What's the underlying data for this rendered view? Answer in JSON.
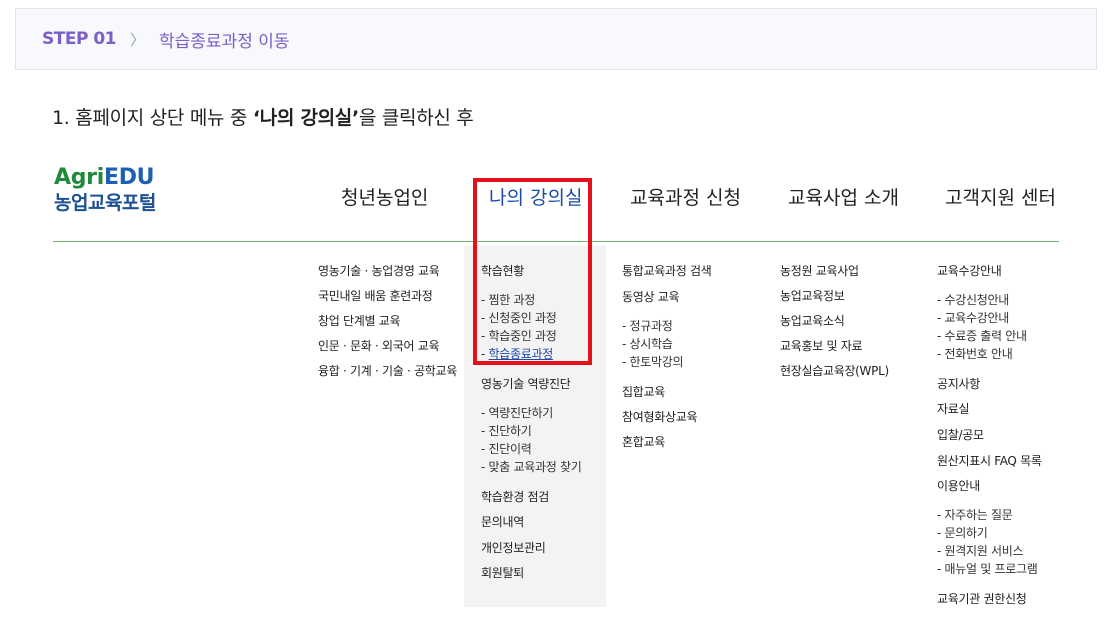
{
  "step": {
    "number": "STEP 01",
    "chevron": "〉",
    "title": "학습종료과정 이동"
  },
  "instruction": {
    "prefix": "1. 홈페이지 상단 메뉴 중 ",
    "highlight": "‘나의 강의실’",
    "suffix": "을 클릭하신 후"
  },
  "logo": {
    "agri": "Agri",
    "edu": "EDU",
    "subtitle": "농업교육포털"
  },
  "gnb": {
    "youth": "청년농업인",
    "my_classroom": "나의 강의실",
    "course_apply": "교육과정 신청",
    "program_intro": "교육사업 소개",
    "support_center": "고객지원 센터"
  },
  "menus": {
    "youth": [
      "영농기술 · 농업경영 교육",
      "국민내일 배움 훈련과정",
      "창업 단계별 교육",
      "인문 · 문화 · 외국어 교육",
      "융합 · 기계 · 기술 · 공학교육"
    ],
    "classroom": {
      "status": "학습현황",
      "status_items": [
        "- 찜한 과정",
        "- 신청중인 과정",
        "- 학습중인 과정"
      ],
      "completed_prefix": "- ",
      "completed": "학습종료과정",
      "diagnosis": "영농기술 역량진단",
      "diagnosis_items": [
        "- 역량진단하기",
        "- 진단하기",
        "- 진단이력",
        "- 맞춤 교육과정 찾기"
      ],
      "environment": "학습환경 점검",
      "inquiry": "문의내역",
      "privacy": "개인정보관리",
      "withdraw": "회원탈퇴"
    },
    "course": {
      "search": "통합교육과정 검색",
      "video": "동영상 교육",
      "video_items": [
        "- 정규과정",
        "- 상시학습",
        "- 한토막강의"
      ],
      "group": "집합교육",
      "participatory": "참여형화상교육",
      "blended": "혼합교육"
    },
    "program": [
      "농정원 교육사업",
      "농업교육정보",
      "농업교육소식",
      "교육홍보 및 자료",
      "현장실습교육장(WPL)"
    ],
    "support": {
      "guide": "교육수강안내",
      "guide_items": [
        "- 수강신청안내",
        "- 교육수강안내",
        "- 수료증 출력 안내",
        "- 전화번호 안내"
      ],
      "notice": "공지사항",
      "archive": "자료실",
      "bid": "입찰/공모",
      "origin_faq": "원산지표시 FAQ 목록",
      "usage": "이용안내",
      "usage_items": [
        "- 자주하는 질문",
        "- 문의하기",
        "- 원격지원 서비스",
        "- 매뉴얼 및 프로그램"
      ],
      "institution": "교육기관 권한신청"
    }
  },
  "highlight_color": "#e4101a"
}
